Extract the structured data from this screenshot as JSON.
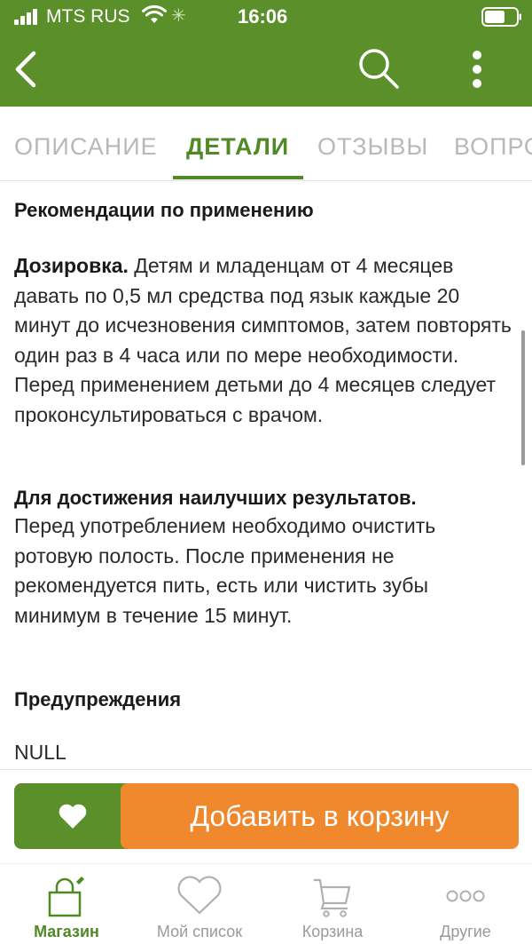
{
  "status_bar": {
    "carrier": "MTS RUS",
    "time": "16:06"
  },
  "header": {
    "back_icon": "chevron-left-icon",
    "search_icon": "search-icon",
    "more_icon": "more-vertical-icon"
  },
  "tabs": [
    {
      "label": "ОПИСАНИЕ",
      "active": false
    },
    {
      "label": "ДЕТАЛИ",
      "active": true
    },
    {
      "label": "ОТЗЫВЫ",
      "active": false
    },
    {
      "label": "ВОПРОСЫ",
      "active": false
    }
  ],
  "content": {
    "usage_title": "Рекомендации по применению",
    "dosage_label": "Дозировка.",
    "dosage_text": " Детям и младенцам от 4 месяцев давать по 0,5 мл средства под язык каждые 20 минут до исчезновения симптомов, затем повторять один раз в 4 часа или по мере необходимости. Перед применением детьми до 4 месяцев следует проконсультироваться с врачом.",
    "best_results_label": "Для достижения наилучших результатов.",
    "best_results_text": "Перед употреблением необходимо очистить ротовую полость. После применения не рекомендуется пить, есть или чистить зубы минимум в течение 15 минут.",
    "warnings_title": "Предупреждения",
    "warnings_value": "NULL"
  },
  "actions": {
    "favorite_icon": "heart-icon",
    "add_to_cart_label": "Добавить в корзину"
  },
  "tabbar": [
    {
      "label": "Магазин",
      "icon": "shop-bag-icon",
      "active": true
    },
    {
      "label": "Мой список",
      "icon": "heart-outline-icon",
      "active": false
    },
    {
      "label": "Корзина",
      "icon": "cart-icon",
      "active": false
    },
    {
      "label": "Другие",
      "icon": "more-horizontal-icon",
      "active": false
    }
  ],
  "colors": {
    "brand_green": "#5a8f2a",
    "accent_orange": "#f0882d",
    "inactive_gray": "#9a9a9a"
  }
}
